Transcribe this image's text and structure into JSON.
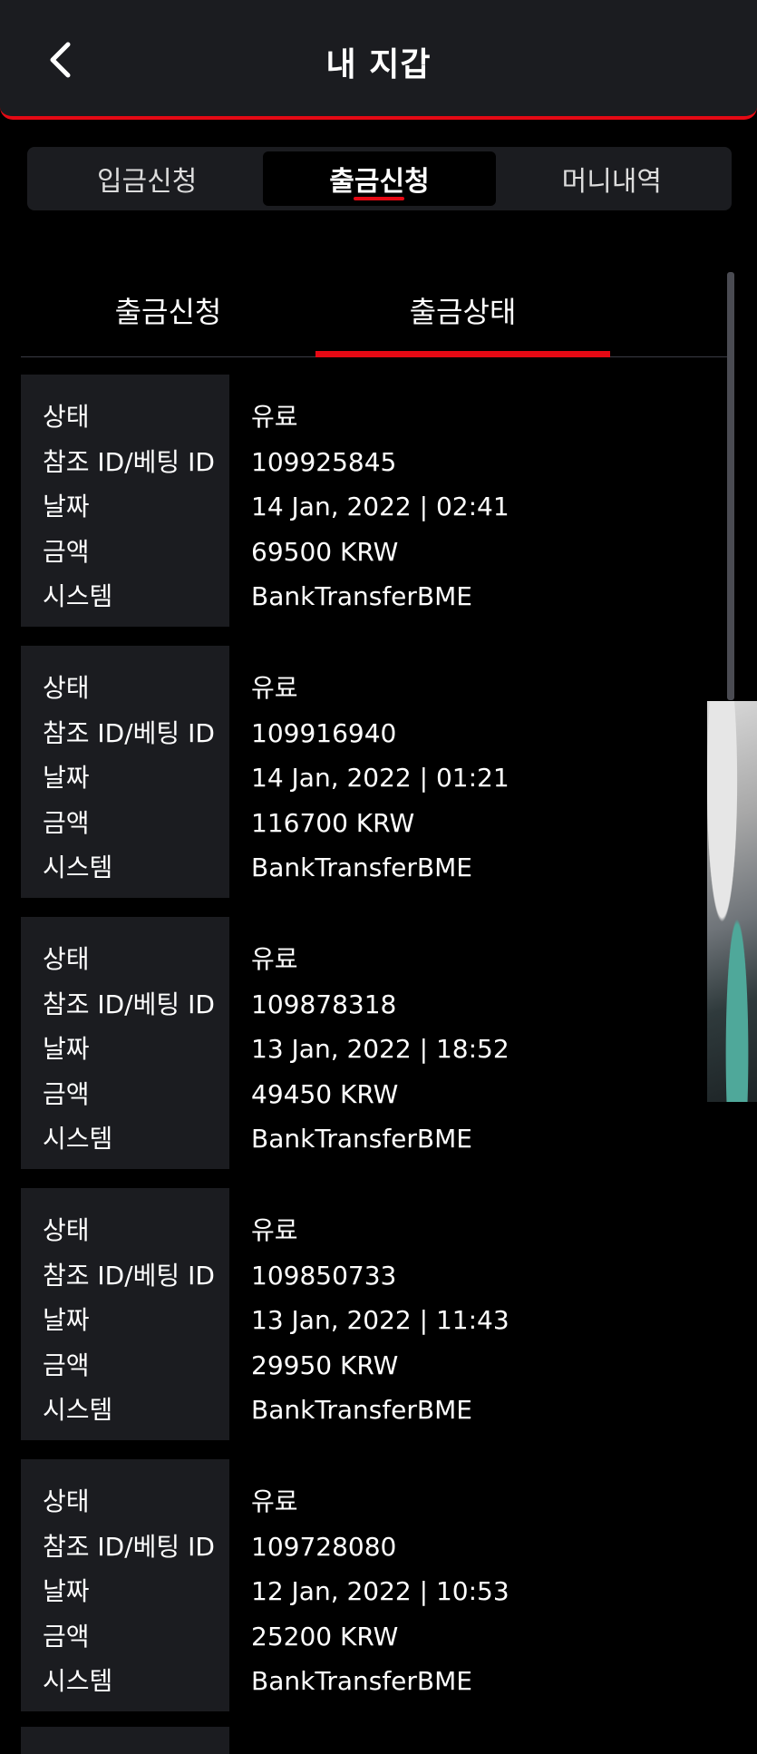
{
  "header": {
    "title": "내 지갑",
    "back_icon": "chevron-left-icon"
  },
  "main_tabs": [
    {
      "label": "입금신청",
      "active": false
    },
    {
      "label": "출금신청",
      "active": true
    },
    {
      "label": "머니내역",
      "active": false
    }
  ],
  "sub_tabs": [
    {
      "label": "출금신청",
      "active": false
    },
    {
      "label": "출금상태",
      "active": true
    }
  ],
  "field_labels": {
    "status": "상태",
    "ref_id": "참조 ID/베팅 ID",
    "date": "날짜",
    "amount": "금액",
    "system": "시스템"
  },
  "records": [
    {
      "status": "유료",
      "ref_id": "109925845",
      "date": "14 Jan, 2022 | 02:41",
      "amount": "69500 KRW",
      "system": "BankTransferBME"
    },
    {
      "status": "유료",
      "ref_id": "109916940",
      "date": "14 Jan, 2022 | 01:21",
      "amount": "116700 KRW",
      "system": "BankTransferBME"
    },
    {
      "status": "유료",
      "ref_id": "109878318",
      "date": "13 Jan, 2022 | 18:52",
      "amount": "49450 KRW",
      "system": "BankTransferBME"
    },
    {
      "status": "유료",
      "ref_id": "109850733",
      "date": "13 Jan, 2022 | 11:43",
      "amount": "29950 KRW",
      "system": "BankTransferBME"
    },
    {
      "status": "유료",
      "ref_id": "109728080",
      "date": "12 Jan, 2022 | 10:53",
      "amount": "25200 KRW",
      "system": "BankTransferBME"
    }
  ],
  "colors": {
    "accent": "#e50914",
    "panel": "#1b1c20",
    "background": "#000000"
  }
}
